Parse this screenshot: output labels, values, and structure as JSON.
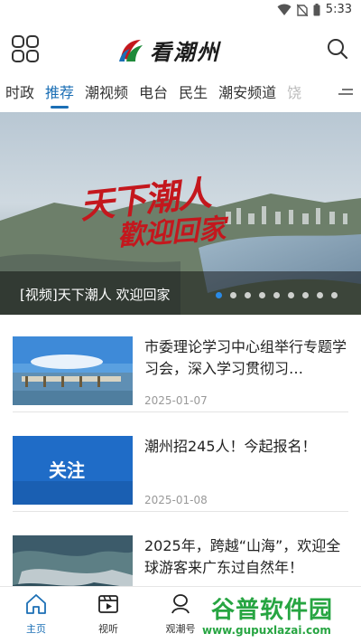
{
  "status_bar": {
    "time": "5:33"
  },
  "header": {
    "app_name": "看潮州"
  },
  "tabs": [
    {
      "label": "时政"
    },
    {
      "label": "推荐"
    },
    {
      "label": "潮视频"
    },
    {
      "label": "电台"
    },
    {
      "label": "民生"
    },
    {
      "label": "潮安频道"
    },
    {
      "label": "饶"
    }
  ],
  "banner": {
    "caption": "[视频]天下潮人 欢迎回家",
    "title_line_1": "天下潮人",
    "title_line_2": "歡迎回家",
    "slide_count": 9,
    "active_slide": 1
  },
  "news": [
    {
      "title": "市委理论学习中心组举行专题学习会，深入学习贯彻习…",
      "date": "2025-01-07",
      "thumb_text": ""
    },
    {
      "title": "潮州招245人！今起报名！",
      "date": "2025-01-08",
      "thumb_text": "关注"
    },
    {
      "title": "2025年，跨越“山海”，欢迎全球游客来广东过自然年！",
      "date": "",
      "thumb_text": ""
    }
  ],
  "bottom_nav": [
    {
      "label": "主页"
    },
    {
      "label": "视听"
    },
    {
      "label": "观潮号"
    }
  ],
  "watermark": {
    "text": "谷普软件园",
    "url": "www.gupuxlazai.com"
  },
  "colors": {
    "accent": "#1b6fb5",
    "banner_title": "#c4171d",
    "watermark": "#27a542"
  }
}
